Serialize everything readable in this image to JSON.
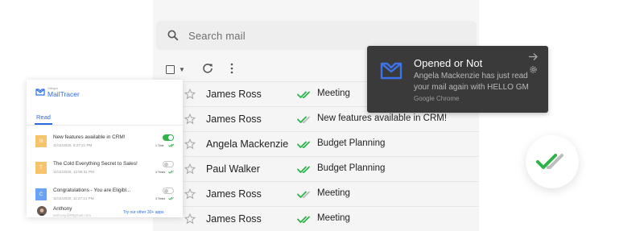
{
  "search": {
    "placeholder": "Search mail"
  },
  "emails": [
    {
      "sender": "James Ross",
      "subject": "Meeting",
      "read": true
    },
    {
      "sender": "James Ross",
      "subject": "New features available in CRM!",
      "read": false
    },
    {
      "sender": "Angela Mackenzie",
      "subject": "Budget Planning",
      "read": true
    },
    {
      "sender": "Paul Walker",
      "subject": "Budget Planning",
      "read": true
    },
    {
      "sender": "James Ross",
      "subject": "Meeting",
      "read": false
    },
    {
      "sender": "James Ross",
      "subject": "Meeting",
      "read": true
    }
  ],
  "notification": {
    "title": "Opened or Not",
    "body": "Angela Mackenzie has just read your mail again with HELLO GM",
    "source": "Google Chrome"
  },
  "panel": {
    "logo_sub": "Gblogco",
    "logo_text": "MailTracer",
    "tab": "Read",
    "items": [
      {
        "letter": "N",
        "color": "#f7c46c",
        "subject": "New features available in CRM!",
        "date": "11/11/2020, 6:27:21 PM",
        "times": "1 Time",
        "tracking": true
      },
      {
        "letter": "T",
        "color": "#f7c46c",
        "subject": "The Cold Everything Secret to Sales!",
        "date": "11/11/2020, 12:56:31 PM",
        "times": "4 Times",
        "tracking": false
      },
      {
        "letter": "C",
        "color": "#6aa3f5",
        "subject": "Congratulations - You are Eligibl...",
        "date": "11/11/2020, 11:27:21 PM",
        "times": "3 Times",
        "tracking": false
      }
    ],
    "partial_item": {
      "name": "Anthony",
      "sub": "anthony@99gmail.com"
    },
    "try_apps": "Try our other 30+ apps"
  },
  "colors": {
    "accent": "#2b6de0",
    "tick_green": "#2db34a",
    "tick_grey": "#b8b8b8",
    "notif_bg": "#3a3a3a"
  }
}
